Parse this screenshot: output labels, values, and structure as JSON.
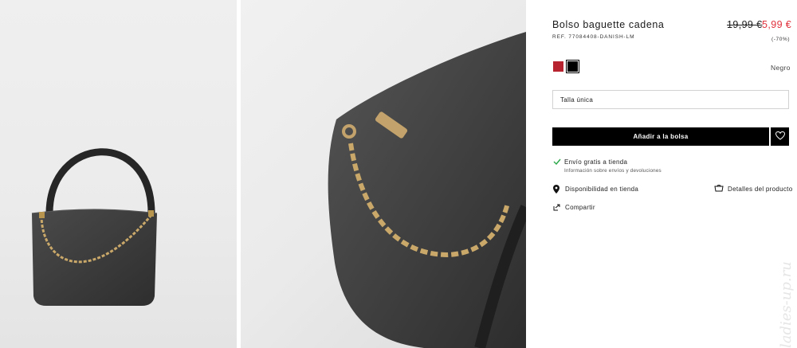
{
  "gallery": {
    "image_1_alt": "Bolso baguette cadena - vista frontal",
    "image_2_alt": "Bolso baguette cadena - detalle"
  },
  "product": {
    "name": "Bolso baguette cadena",
    "ref": "REF. 77084408-DANISH-LM",
    "price_old": "19,99 €",
    "price_new": "5,99 €",
    "discount": "(-70%)",
    "price_new_color": "#e0303c"
  },
  "colors": {
    "options": [
      {
        "name": "red",
        "hex": "#b7242f"
      },
      {
        "name": "Negro",
        "hex": "#000000"
      }
    ],
    "selected_label": "Negro"
  },
  "size": {
    "selected": "Talla única"
  },
  "actions": {
    "add_to_bag": "Añadir a la bolsa",
    "wishlist_icon": "heart-icon"
  },
  "shipping": {
    "title": "Envío gratis a tienda",
    "subtitle": "Información sobre envíos y devoluciones"
  },
  "links": {
    "availability": "Disponibilidad en tienda",
    "details": "Detalles del producto",
    "share": "Compartir"
  }
}
